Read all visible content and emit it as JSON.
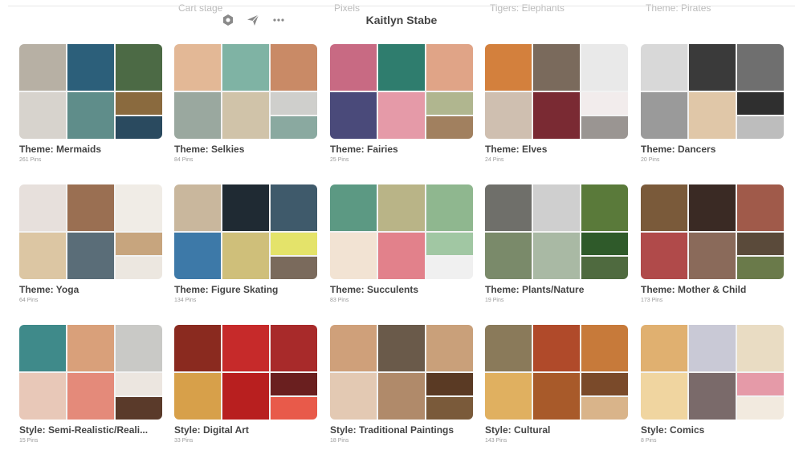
{
  "ghost_row": [
    "Cart stage",
    "Pixels",
    "Tigers: Elephants",
    "Theme: Pirates"
  ],
  "header": {
    "owner_name": "Kaitlyn Stabe",
    "icons": [
      "settings-hex-icon",
      "send-icon",
      "more-dots-icon"
    ]
  },
  "boards": [
    {
      "title": "Theme: Mermaids",
      "count": "261 Pins",
      "colors": [
        "#b7b0a4",
        "#2c5f7a",
        "#4c6a45",
        "#d7d3cd",
        "#5f8d8a",
        "#8a6a3e",
        "#2a4a5f"
      ]
    },
    {
      "title": "Theme: Selkies",
      "count": "84 Pins",
      "colors": [
        "#e3b896",
        "#7fb3a4",
        "#c98a66",
        "#9aa89f",
        "#d0c3a9",
        "#cfcfcc",
        "#8aa9a0"
      ]
    },
    {
      "title": "Theme: Fairies",
      "count": "25 Pins",
      "colors": [
        "#c86a83",
        "#2f7d6e",
        "#e0a487",
        "#4a4a7a",
        "#e59aa8",
        "#b0b68f",
        "#a1805f"
      ]
    },
    {
      "title": "Theme: Elves",
      "count": "24 Pins",
      "colors": [
        "#d3803d",
        "#7a6a5c",
        "#e9e9e9",
        "#cfbfb0",
        "#7a2a33",
        "#f2ecec",
        "#9a9592"
      ]
    },
    {
      "title": "Theme: Dancers",
      "count": "20 Pins",
      "colors": [
        "#d8d8d8",
        "#3a3a3a",
        "#6f6f6f",
        "#9a9a9a",
        "#e0c7a8",
        "#2f2f2f",
        "#bdbdbd"
      ]
    },
    {
      "title": "Theme: Yoga",
      "count": "64 Pins",
      "colors": [
        "#e7e0dc",
        "#9a6f52",
        "#f0ece6",
        "#dcc6a3",
        "#5a6d78",
        "#c7a57e",
        "#ece7e0"
      ]
    },
    {
      "title": "Theme: Figure Skating",
      "count": "134 Pins",
      "colors": [
        "#c9b79d",
        "#1f2a33",
        "#3f5a6b",
        "#3d79a8",
        "#cfbf7a",
        "#e4e36a",
        "#7a6a5c"
      ]
    },
    {
      "title": "Theme: Succulents",
      "count": "83 Pins",
      "colors": [
        "#5c9983",
        "#b9b487",
        "#8fb78f",
        "#f2e3d3",
        "#e2818b",
        "#a1c7a3",
        "#f0f0f0"
      ]
    },
    {
      "title": "Theme: Plants/Nature",
      "count": "19 Pins",
      "colors": [
        "#6f6f6a",
        "#cfcfcf",
        "#5a7a3a",
        "#7a8a6a",
        "#a9b9a4",
        "#2f5a2a",
        "#4f6a3f"
      ]
    },
    {
      "title": "Theme: Mother & Child",
      "count": "173 Pins",
      "colors": [
        "#7a5a3a",
        "#3a2a24",
        "#a05a4a",
        "#b04a4a",
        "#8a6a5a",
        "#5a4a3a",
        "#6a7a4a"
      ]
    },
    {
      "title": "Style: Semi-Realistic/Reali...",
      "count": "15 Pins",
      "colors": [
        "#3f8a8a",
        "#d9a07a",
        "#c9c9c6",
        "#e8c8b8",
        "#e48a7a",
        "#ece6e0",
        "#5a3a2a"
      ]
    },
    {
      "title": "Style: Digital Art",
      "count": "33 Pins",
      "colors": [
        "#8a2a1f",
        "#c62a2a",
        "#a82a2a",
        "#d7a04a",
        "#b81f1f",
        "#6a1f1f",
        "#e85a4a"
      ]
    },
    {
      "title": "Style: Traditional Paintings",
      "count": "18 Pins",
      "colors": [
        "#cfa07a",
        "#6a5a4a",
        "#c9a07a",
        "#e3c9b3",
        "#b08a6a",
        "#5a3a24",
        "#7a5a3a"
      ]
    },
    {
      "title": "Style: Cultural",
      "count": "143 Pins",
      "colors": [
        "#8a7a5a",
        "#b04a2a",
        "#c77a3a",
        "#e0b060",
        "#a85a2a",
        "#7a4a2a",
        "#d9b48a"
      ]
    },
    {
      "title": "Style: Comics",
      "count": "8 Pins",
      "colors": [
        "#e0b070",
        "#c9c9d6",
        "#e9dcc3",
        "#f0d5a0",
        "#7a6a6a",
        "#e59aa8",
        "#f2eadf"
      ]
    }
  ]
}
